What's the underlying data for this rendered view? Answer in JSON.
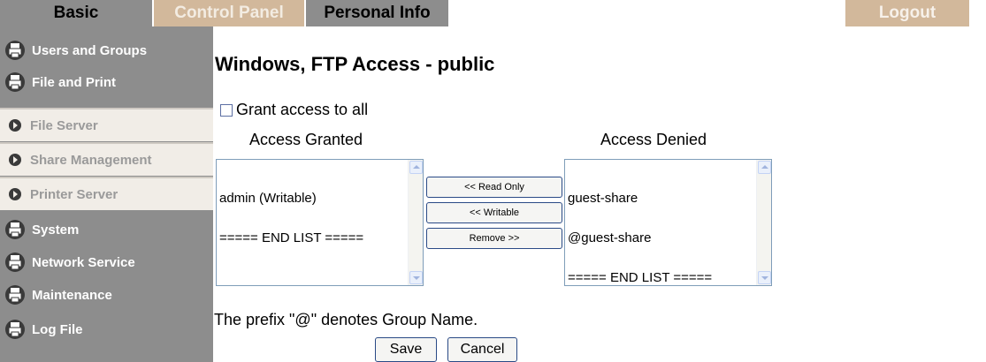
{
  "top_tabs": {
    "basic": "Basic",
    "control_panel": "Control Panel",
    "personal_info": "Personal Info",
    "logout": "Logout"
  },
  "sidebar": {
    "items": [
      {
        "label": "Users and Groups",
        "kind": "group",
        "icon": "printer-icon"
      },
      {
        "label": "File and Print",
        "kind": "group",
        "icon": "printer-icon"
      },
      {
        "label": "File Server",
        "kind": "sub",
        "icon": "arrow-bullet-icon"
      },
      {
        "label": "Share Management",
        "kind": "sub",
        "icon": "arrow-bullet-icon"
      },
      {
        "label": "Printer Server",
        "kind": "sub",
        "icon": "arrow-bullet-icon"
      },
      {
        "label": "System",
        "kind": "group",
        "icon": "printer-icon"
      },
      {
        "label": "Network Service",
        "kind": "group",
        "icon": "printer-icon"
      },
      {
        "label": "Maintenance",
        "kind": "group",
        "icon": "printer-icon"
      },
      {
        "label": "Log File",
        "kind": "group",
        "icon": "printer-icon"
      }
    ]
  },
  "main": {
    "title": "Windows, FTP Access - public",
    "grant_all_label": "Grant access to all",
    "grant_all_checked": false,
    "granted": {
      "title": "Access Granted",
      "items": [
        "admin (Writable)",
        "===== END LIST ====="
      ]
    },
    "denied": {
      "title": "Access Denied",
      "items": [
        "guest-share",
        "@guest-share",
        "===== END LIST ====="
      ]
    },
    "buttons": {
      "read_only": "<< Read Only",
      "writable": "<< Writable",
      "remove": "Remove >>"
    },
    "prefix_note": "The prefix \"@\" denotes Group Name.",
    "save": "Save",
    "cancel": "Cancel"
  },
  "colors": {
    "tab_active": "#d2b89b",
    "tab_inactive": "#8d8d8d",
    "sidebar_bg": "#8d8d8d",
    "sidebar_sub_bg": "#f1ede7"
  }
}
